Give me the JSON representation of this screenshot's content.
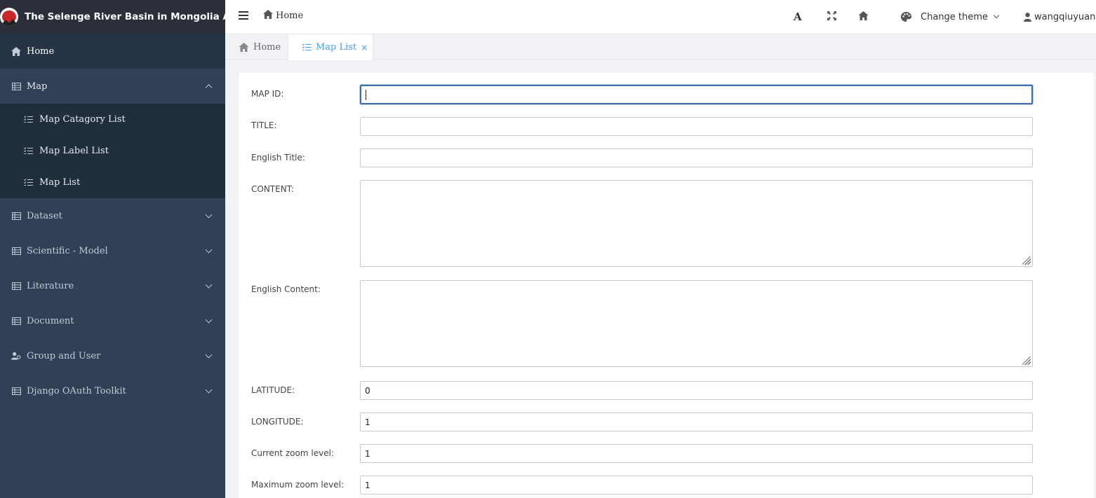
{
  "app": {
    "title": "The Selenge River Basin in Mongolia Admin"
  },
  "sidebar": {
    "items": [
      {
        "label": "Home",
        "icon": "home-icon"
      },
      {
        "label": "Map",
        "icon": "table-icon",
        "expanded": true,
        "children": [
          {
            "label": "Map Catagory List",
            "icon": "list-icon"
          },
          {
            "label": "Map Label List",
            "icon": "list-icon"
          },
          {
            "label": "Map List",
            "icon": "list-icon"
          }
        ]
      },
      {
        "label": "Dataset",
        "icon": "table-icon"
      },
      {
        "label": "Scientific - Model",
        "icon": "table-icon"
      },
      {
        "label": "Literature",
        "icon": "table-icon"
      },
      {
        "label": "Document",
        "icon": "table-icon"
      },
      {
        "label": "Group and User",
        "icon": "user-group-icon"
      },
      {
        "label": "Django OAuth Toolkit",
        "icon": "table-icon"
      }
    ]
  },
  "navbar": {
    "breadcrumb": "Home",
    "font_glyph": "A",
    "theme_label": "Change theme",
    "username": "wangqiuyuan"
  },
  "tabs": [
    {
      "label": "Home",
      "active": false
    },
    {
      "label": "Map List",
      "active": true,
      "close": "×"
    }
  ],
  "form": {
    "fields": [
      {
        "label": "MAP ID:",
        "value": ""
      },
      {
        "label": "TITLE:",
        "value": ""
      },
      {
        "label": "English Title:",
        "value": ""
      },
      {
        "label": "CONTENT:",
        "value": ""
      },
      {
        "label": "English Content:",
        "value": ""
      },
      {
        "label": "LATITUDE:",
        "value": "0"
      },
      {
        "label": "LONGITUDE:",
        "value": "1"
      },
      {
        "label": "Current zoom level:",
        "value": "1"
      },
      {
        "label": "Maximum zoom level:",
        "value": "1"
      }
    ]
  },
  "colors": {
    "sidebar": "#304156",
    "submenu": "#1f2d3d",
    "accent": "#409eff"
  }
}
